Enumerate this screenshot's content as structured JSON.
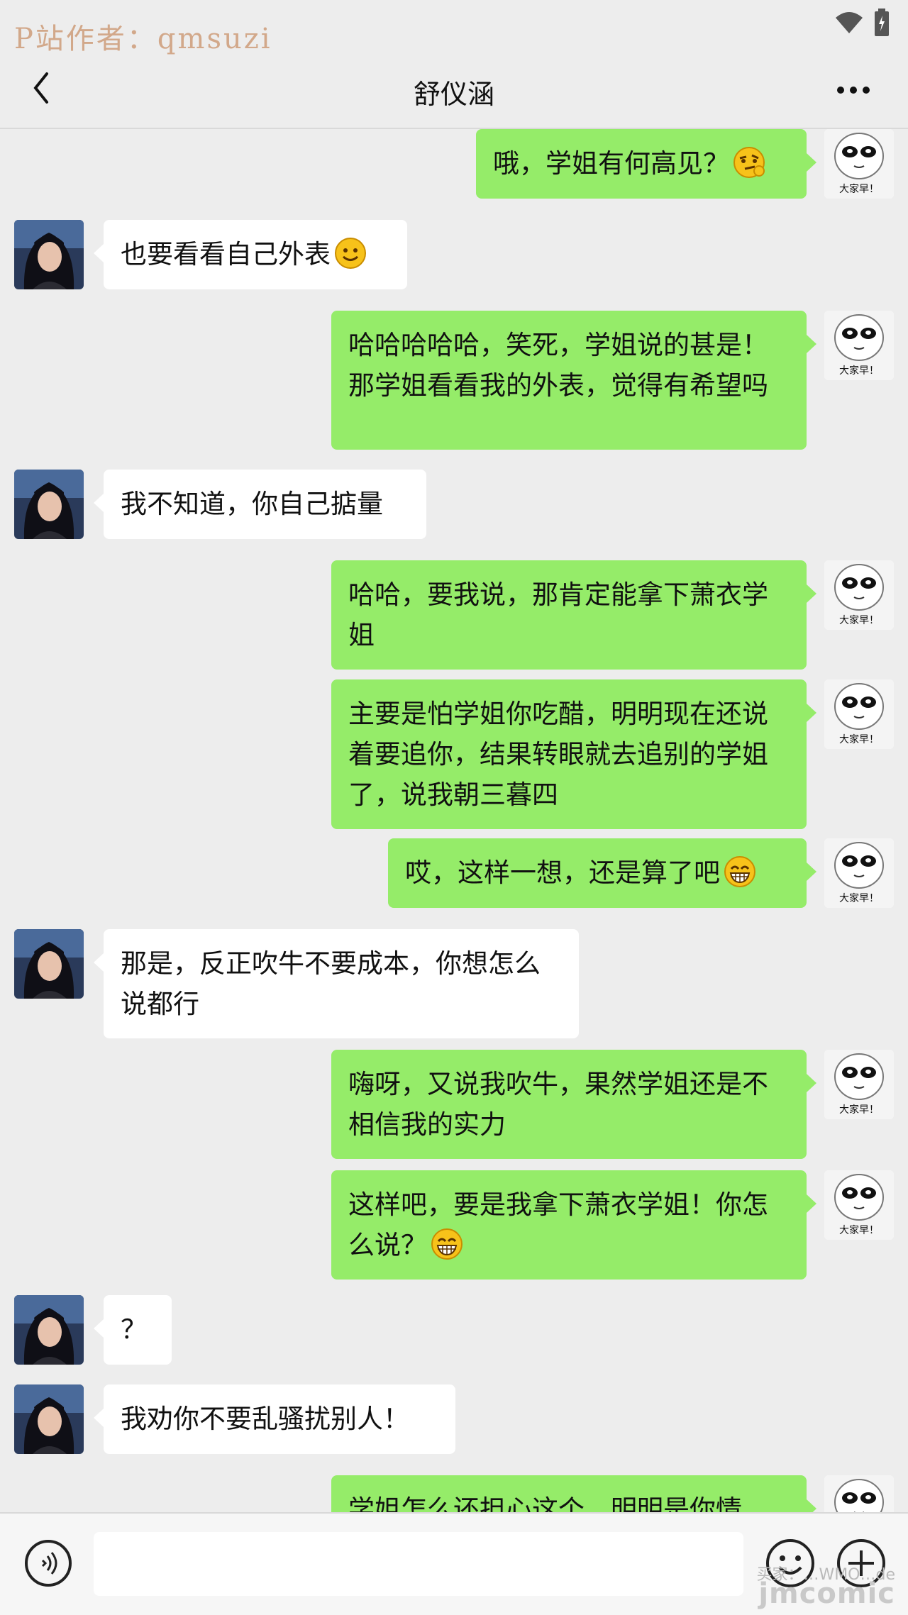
{
  "watermark": "P站作者：qmsuzi",
  "header": {
    "title": "舒仪涵"
  },
  "icons": {
    "back": "chevron-left-icon",
    "more": "more-dots-icon",
    "wifi": "wifi-icon",
    "battery": "battery-icon",
    "voice": "voice-icon",
    "emoji": "emoji-icon",
    "plus": "plus-icon"
  },
  "colors": {
    "outgoing_bubble": "#95ec69",
    "incoming_bubble": "#ffffff",
    "background": "#ededed"
  },
  "avatar_right_caption": "大家早！",
  "messages": [
    {
      "from": "me",
      "text": "哦，学姐有何高见？",
      "emoji": "thinking"
    },
    {
      "from": "her",
      "text": "也要看看自己外表",
      "emoji": "smile"
    },
    {
      "from": "me",
      "text": "哈哈哈哈哈，笑死，学姐说的甚是！那学姐看看我的外表，觉得有希望吗"
    },
    {
      "from": "her",
      "text": "我不知道，你自己掂量"
    },
    {
      "from": "me",
      "text": "哈哈，要我说，那肯定能拿下萧衣学姐"
    },
    {
      "from": "me",
      "text": "主要是怕学姐你吃醋，明明现在还说着要追你，结果转眼就去追别的学姐了，说我朝三暮四"
    },
    {
      "from": "me",
      "text": "哎，这样一想，还是算了吧",
      "emoji": "grin"
    },
    {
      "from": "her",
      "text": "那是，反正吹牛不要成本，你想怎么说都行"
    },
    {
      "from": "me",
      "text": "嗨呀，又说我吹牛，果然学姐还是不相信我的实力"
    },
    {
      "from": "me",
      "text": "这样吧，要是我拿下萧衣学姐！你怎么说？",
      "emoji": "grin"
    },
    {
      "from": "her",
      "text": "？"
    },
    {
      "from": "her",
      "text": "我劝你不要乱骚扰别人！"
    },
    {
      "from": "me",
      "text": "学姐怎么还担心这个，明明是你情"
    }
  ],
  "site_mark": {
    "line1": "买家：…WMO…de",
    "line2": "jmcomic"
  }
}
